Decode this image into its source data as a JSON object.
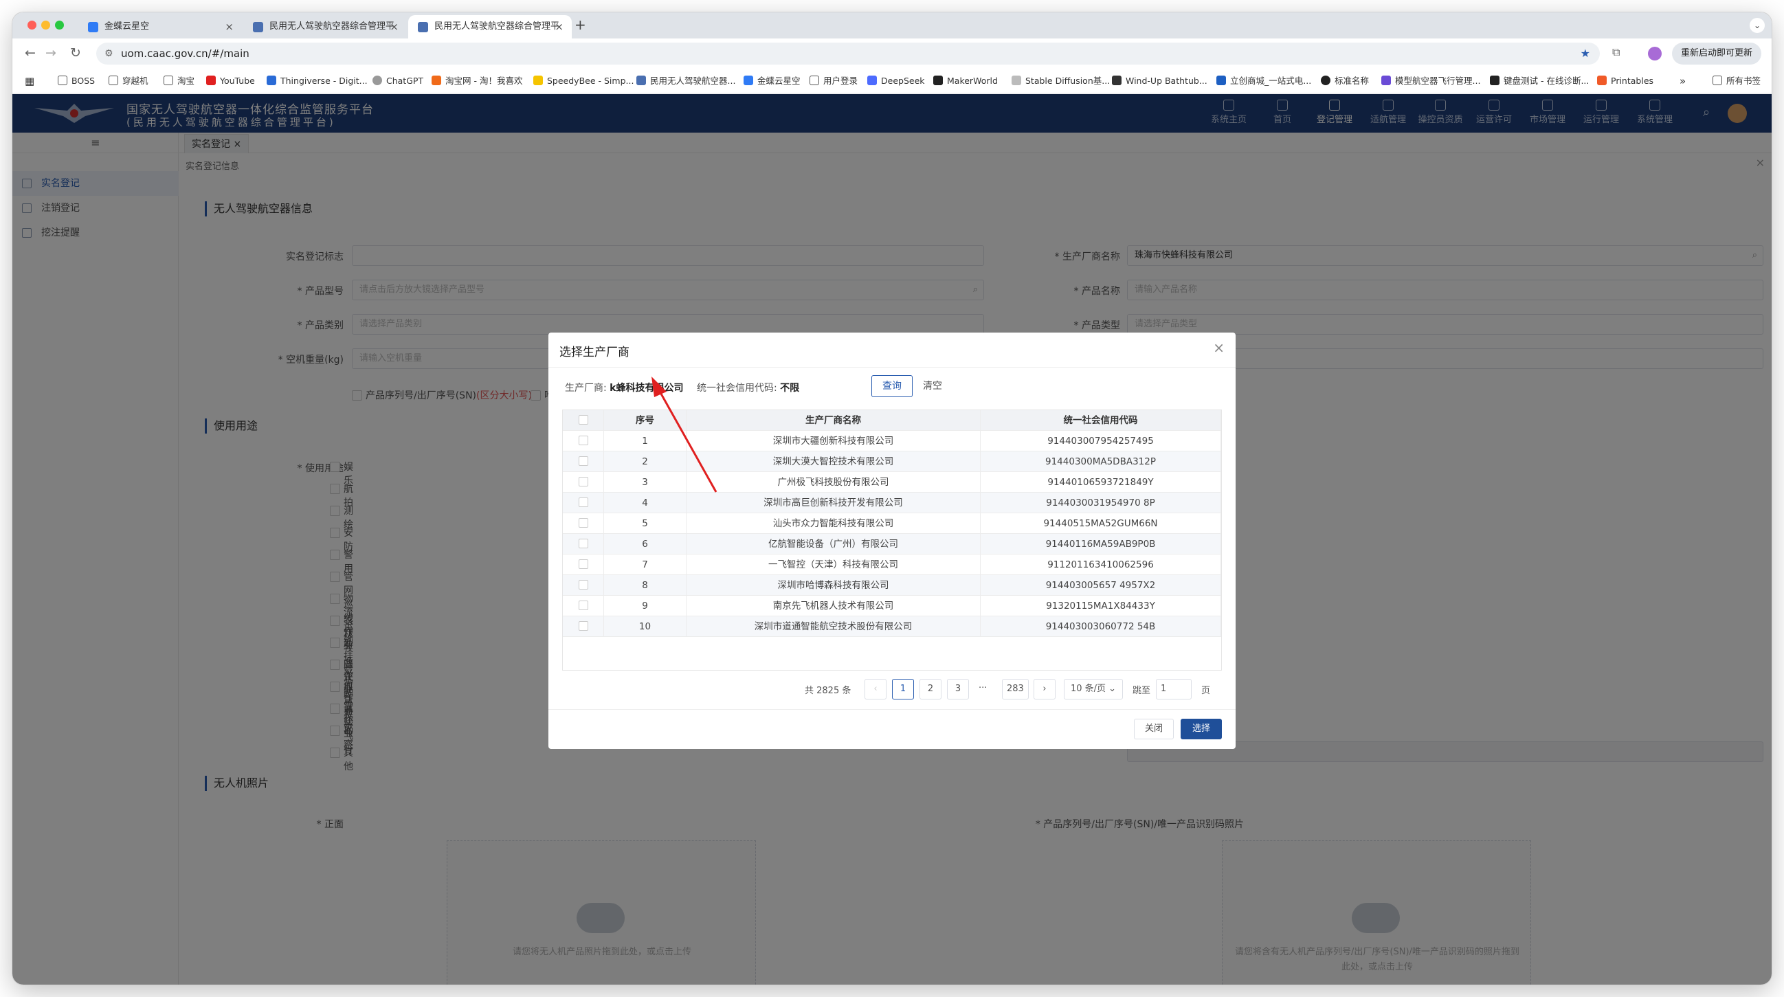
{
  "browser": {
    "tabs": [
      {
        "title": "金蝶云星空"
      },
      {
        "title": "民用无人驾驶航空器综合管理平"
      },
      {
        "title": "民用无人驾驶航空器综合管理平"
      }
    ],
    "url": "uom.caac.gov.cn/#/main",
    "restart_label": "重新启动即可更新",
    "bookmarks": [
      "BOSS",
      "穿越机",
      "淘宝",
      "YouTube",
      "Thingiverse - Digit...",
      "ChatGPT",
      "淘宝网 - 淘！我喜欢",
      "SpeedyBee - Simp...",
      "民用无人驾驶航空器...",
      "金蝶云星空",
      "用户登录",
      "DeepSeek",
      "MakerWorld",
      "Stable Diffusion基...",
      "Wind-Up Bathtub...",
      "立创商城_一站式电...",
      "标准名称",
      "模型航空器飞行管理...",
      "键盘测试 - 在线诊断...",
      "Printables"
    ],
    "all_bookmarks": "所有书签"
  },
  "app": {
    "title_line1": "国家无人驾驶航空器一体化综合监管服务平台",
    "title_line2": "(民用无人驾驶航空器综合管理平台)",
    "nav": [
      "系统主页",
      "首页",
      "登记管理",
      "适航管理",
      "操控员资质",
      "运营许可",
      "市场管理",
      "运行管理",
      "系统管理"
    ],
    "sidebar": [
      "实名登记",
      "注销登记",
      "挖注提醒"
    ],
    "content_tab": "实名登记",
    "breadcrumb": "实名登记信息"
  },
  "form": {
    "section1": "无人驾驶航空器信息",
    "section2": "使用用途",
    "section3": "无人机照片",
    "fields": {
      "reg_mark": "实名登记标志",
      "manufacturer": "* 生产厂商名称",
      "manufacturer_value": "珠海市快蜂科技有限公司",
      "model": "* 产品型号",
      "model_ph": "请点击后方放大镜选择产品型号",
      "product_name": "* 产品名称",
      "product_name_ph": "请输入产品名称",
      "category": "* 产品类别",
      "category_ph": "请选择产品类别",
      "type": "* 产品类型",
      "type_ph": "请选择产品类型",
      "weight": "* 空机重量(kg)",
      "weight_ph": "请输入空机重量",
      "sn_option": "产品序列号/出厂序号(SN)",
      "sn_case": "(区分大小写)",
      "uid_option": "唯一",
      "usage_label": "* 使用用途",
      "front_label": "* 正面",
      "sn_photo_label": "* 产品序列号/出厂序号(SN)/唯一产品识别码照片"
    },
    "usages": [
      "娱乐",
      "航拍",
      "测绘",
      "安防",
      "警用",
      "管网巡线作业",
      "物流运输",
      "农林牧渔作业",
      "外挂载荷作业",
      "降水融雪作业",
      "应急救灾",
      "试验飞行",
      "勘察",
      "其他"
    ],
    "upload_hint1": "请您将无人机产品照片拖到此处，或点击上传",
    "upload_hint2a": "请您将含有无人机产品序列号/出厂序号(SN)/唯一产品识别码的照片拖到",
    "upload_hint2b": "此处，或点击上传"
  },
  "modal": {
    "title": "选择生产厂商",
    "query_manufacturer_label": "生产厂商:",
    "query_manufacturer_value": "k蜂科技有限公司",
    "query_credit_label": "统一社会信用代码:",
    "query_credit_value": "不限",
    "query_btn": "查询",
    "clear_btn": "清空",
    "columns": [
      "序号",
      "生产厂商名称",
      "统一社会信用代码"
    ],
    "rows": [
      [
        "1",
        "深圳市大疆创新科技有限公司",
        "914403007954257495"
      ],
      [
        "2",
        "深圳大漠大智控技术有限公司",
        "91440300MA5DBA312P"
      ],
      [
        "3",
        "广州极飞科技股份有限公司",
        "91440106593721849Y"
      ],
      [
        "4",
        "深圳市高巨创新科技开发有限公司",
        "9144030031954970 8P"
      ],
      [
        "5",
        "汕头市众力智能科技有限公司",
        "91440515MA52GUM66N"
      ],
      [
        "6",
        "亿航智能设备（广州）有限公司",
        "91440116MA59AB9P0B"
      ],
      [
        "7",
        "一飞智控（天津）科技有限公司",
        "911201163410062596"
      ],
      [
        "8",
        "深圳市哈博森科技有限公司",
        "914403005657 4957X2"
      ],
      [
        "9",
        "南京先飞机器人技术有限公司",
        "91320115MA1X84433Y"
      ],
      [
        "10",
        "深圳市道通智能航空技术股份有限公司",
        "914403003060772 54B"
      ]
    ],
    "total": "共 2825 条",
    "pages": [
      "1",
      "2",
      "3",
      "···",
      "283"
    ],
    "page_size": "10 条/页",
    "jump_label": "跳至",
    "jump_value": "1",
    "page_unit": "页",
    "close_btn": "关闭",
    "select_btn": "选择"
  },
  "colors": {
    "header": "#1f3f7a",
    "accent": "#2a5db0",
    "annotation_arrow": "#e02020"
  }
}
